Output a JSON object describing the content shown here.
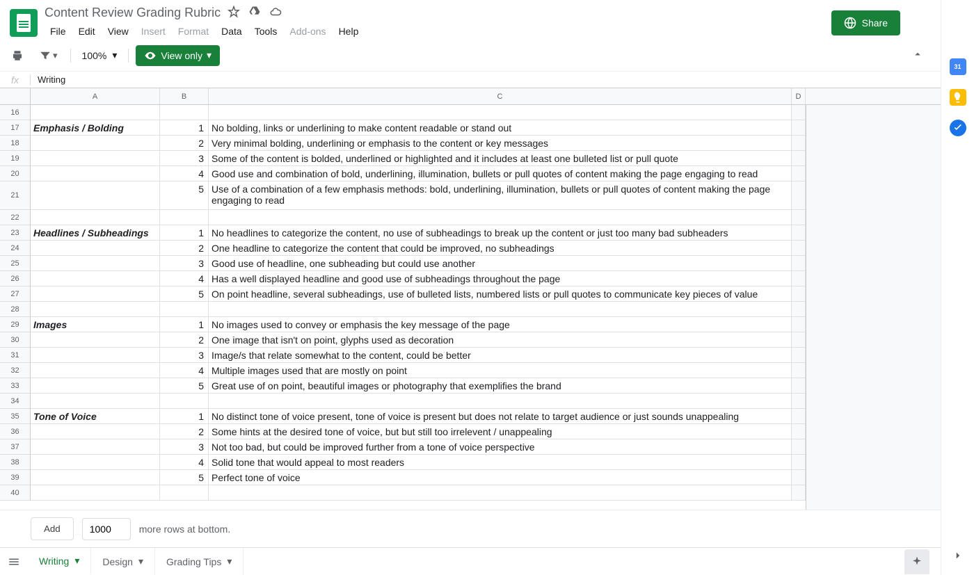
{
  "header": {
    "doc_title": "Content Review Grading Rubric",
    "share_label": "Share"
  },
  "menu": {
    "file": "File",
    "edit": "Edit",
    "view": "View",
    "insert": "Insert",
    "format": "Format",
    "data": "Data",
    "tools": "Tools",
    "addons": "Add-ons",
    "help": "Help"
  },
  "toolbar": {
    "zoom": "100%",
    "viewonly": "View only"
  },
  "formula": {
    "fx": "fx",
    "value": "Writing"
  },
  "columns": {
    "A": "A",
    "B": "B",
    "C": "C",
    "D": "D"
  },
  "rows": [
    {
      "n": 16,
      "a": "",
      "b": "",
      "c": ""
    },
    {
      "n": 17,
      "a": "Emphasis / Bolding",
      "b": "1",
      "c": "No bolding, links or underlining to make content readable or stand out"
    },
    {
      "n": 18,
      "a": "",
      "b": "2",
      "c": "Very minimal bolding, underlining or emphasis to the content or key messages"
    },
    {
      "n": 19,
      "a": "",
      "b": "3",
      "c": "Some of the content is bolded, underlined or highlighted and it includes at least one bulleted list or pull quote"
    },
    {
      "n": 20,
      "a": "",
      "b": "4",
      "c": "Good use and combination of bold, underlining, illumination, bullets or pull quotes of content making the page engaging to read"
    },
    {
      "n": 21,
      "a": "",
      "b": "5",
      "c": "Use of a combination of a few emphasis methods: bold, underlining, illumination, bullets or pull quotes of content making the page engaging to read",
      "tall": true
    },
    {
      "n": 22,
      "a": "",
      "b": "",
      "c": ""
    },
    {
      "n": 23,
      "a": "Headlines / Subheadings",
      "b": "1",
      "c": "No headlines to categorize the content, no use of subheadings to break up the content or just too many bad subheaders"
    },
    {
      "n": 24,
      "a": "",
      "b": "2",
      "c": "One headline to categorize the content that could be improved, no subheadings"
    },
    {
      "n": 25,
      "a": "",
      "b": "3",
      "c": "Good use of headline, one subheading but could use another"
    },
    {
      "n": 26,
      "a": "",
      "b": "4",
      "c": "Has a well displayed headline and good use of subheadings throughout the page"
    },
    {
      "n": 27,
      "a": "",
      "b": "5",
      "c": "On point headline, several subheadings, use of bulleted lists, numbered lists or pull quotes to communicate key pieces of value"
    },
    {
      "n": 28,
      "a": "",
      "b": "",
      "c": ""
    },
    {
      "n": 29,
      "a": "Images",
      "b": "1",
      "c": "No images used to convey or emphasis the key message of the page"
    },
    {
      "n": 30,
      "a": "",
      "b": "2",
      "c": "One image that isn't on point, glyphs used as decoration"
    },
    {
      "n": 31,
      "a": "",
      "b": "3",
      "c": "Image/s that relate somewhat to the content, could be better"
    },
    {
      "n": 32,
      "a": "",
      "b": "4",
      "c": "Multiple images used that are mostly on point"
    },
    {
      "n": 33,
      "a": "",
      "b": "5",
      "c": "Great use of on point, beautiful images or photography that exemplifies the brand"
    },
    {
      "n": 34,
      "a": "",
      "b": "",
      "c": ""
    },
    {
      "n": 35,
      "a": "Tone of Voice",
      "b": "1",
      "c": "No distinct tone of voice present, tone of voice is present but does not relate to target audience or just sounds unappealing"
    },
    {
      "n": 36,
      "a": "",
      "b": "2",
      "c": "Some hints at the desired tone of voice, but but still too irrelevent / unappealing"
    },
    {
      "n": 37,
      "a": "",
      "b": "3",
      "c": "Not too bad, but could be improved further from a tone of voice perspective"
    },
    {
      "n": 38,
      "a": "",
      "b": "4",
      "c": "Solid tone that would appeal to most readers"
    },
    {
      "n": 39,
      "a": "",
      "b": "5",
      "c": "Perfect tone of voice"
    },
    {
      "n": 40,
      "a": "",
      "b": "",
      "c": ""
    }
  ],
  "addrow": {
    "add_label": "Add",
    "count": "1000",
    "suffix": "more rows at bottom."
  },
  "tabs": {
    "writing": "Writing",
    "design": "Design",
    "grading": "Grading Tips"
  },
  "sidepanel": {
    "cal": "31"
  }
}
